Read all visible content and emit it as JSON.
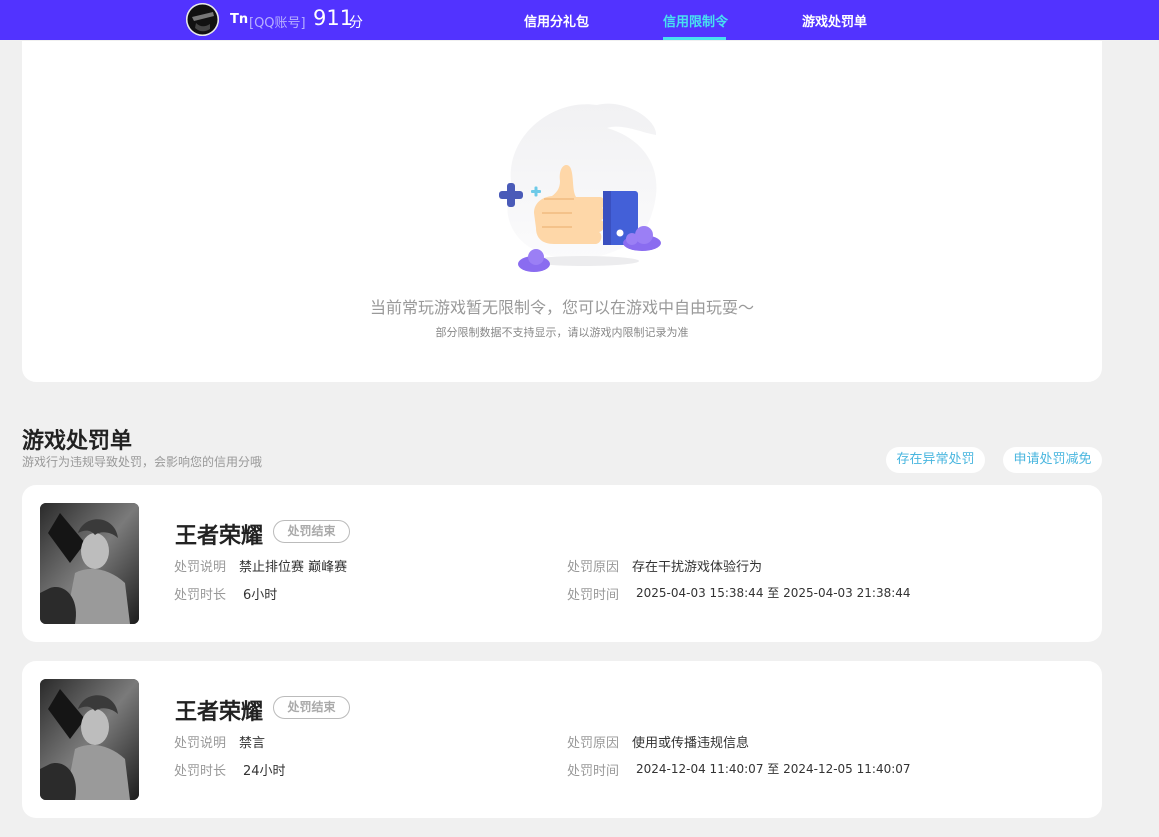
{
  "header": {
    "username": "Tn",
    "account_tag": "[QQ账号]",
    "score": "911",
    "score_unit": "分",
    "tabs": [
      {
        "label": "信用分礼包",
        "active": false
      },
      {
        "label": "信用限制令",
        "active": true
      },
      {
        "label": "游戏处罚单",
        "active": false
      }
    ]
  },
  "empty_state": {
    "message": "当前常玩游戏暂无限制令，您可以在游戏中自由玩耍～",
    "note": "部分限制数据不支持显示，请以游戏内限制记录为准"
  },
  "penalty_section": {
    "title": "游戏处罚单",
    "subtitle": "游戏行为违规导致处罚，会影响您的信用分哦",
    "actions": [
      "存在异常处罚",
      "申请处罚减免"
    ],
    "labels": {
      "description": "处罚说明",
      "duration": "处罚时长",
      "reason": "处罚原因",
      "time": "处罚时间"
    },
    "items": [
      {
        "game": "王者荣耀",
        "status": "处罚结束",
        "description": "禁止排位赛 巅峰赛",
        "duration": "6小时",
        "reason": "存在干扰游戏体验行为",
        "time": "2025-04-03 15:38:44 至 2025-04-03 21:38:44"
      },
      {
        "game": "王者荣耀",
        "status": "处罚结束",
        "description": "禁言",
        "duration": "24小时",
        "reason": "使用或传播违规信息",
        "time": "2024-12-04 11:40:07 至 2024-12-05 11:40:07"
      }
    ]
  },
  "colors": {
    "header_bg": "#5233ff",
    "active_tab": "#48e0f0",
    "action_text": "#49b6df"
  }
}
